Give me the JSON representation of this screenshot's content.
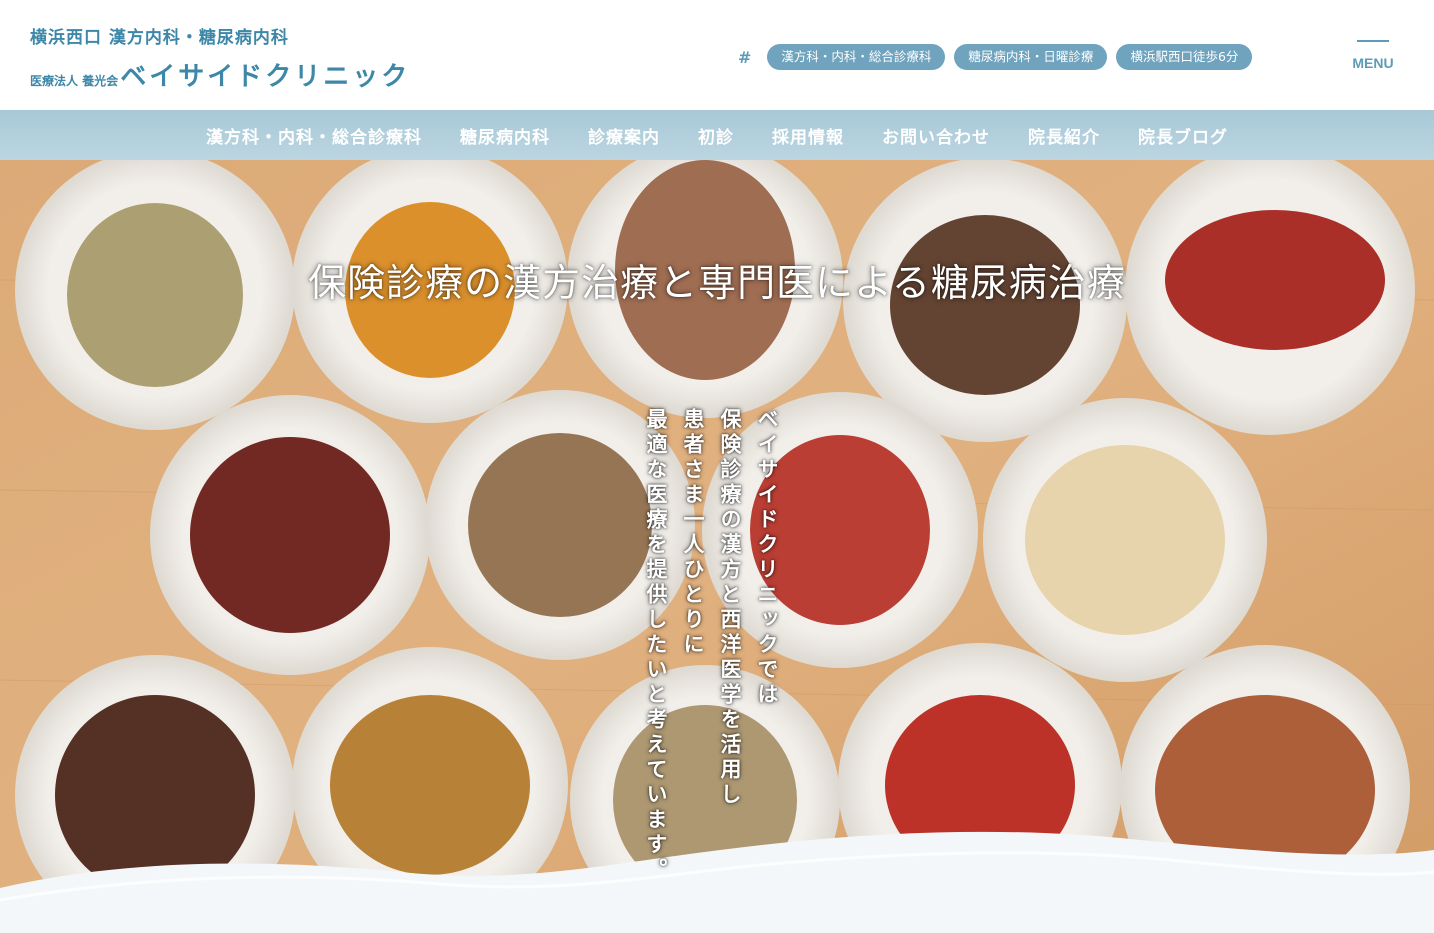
{
  "header": {
    "subtitle": "横浜西口 漢方内科・糖尿病内科",
    "corp": "医療法人 養光会",
    "clinic_name": "ベイサイドクリニック",
    "hash": "#",
    "tags": [
      "漢方科・内科・総合診療科",
      "糖尿病内科・日曜診療",
      "横浜駅西口徒歩6分"
    ],
    "menu_label": "MENU"
  },
  "nav": {
    "items": [
      "漢方科・内科・総合診療科",
      "糖尿病内科",
      "診療案内",
      "初診",
      "採用情報",
      "お問い合わせ",
      "院長紹介",
      "院長ブログ"
    ]
  },
  "hero": {
    "title": "保険診療の漢方治療と専門医による糖尿病治療",
    "lines": [
      "ベイサイドクリニックでは",
      "保険診療の漢方と西洋医学を活用し",
      "患者さま一人ひとりに",
      "最適な医療を提供したいと考えています。"
    ]
  },
  "colors": {
    "brand": "#3d87a8",
    "tag_bg": "#6fa3be",
    "nav_bg": "#b1cfdc",
    "table_wood": "#d8a06a"
  }
}
